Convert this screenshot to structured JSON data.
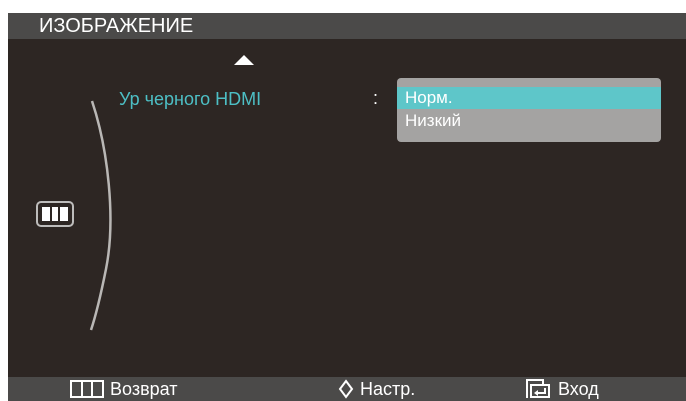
{
  "menu": {
    "title": "ИЗОБРАЖЕНИЕ"
  },
  "setting": {
    "label": "Ур черного HDMI",
    "separator": ":"
  },
  "dropdown": {
    "options": [
      "Норм.",
      "Низкий"
    ],
    "selected": "Норм."
  },
  "footer": {
    "back_label": "Возврат",
    "adjust_label": "Настр.",
    "enter_label": "Вход"
  },
  "colors": {
    "accent": "#4dbfc5",
    "selection": "#5ec6c9",
    "background": "#2d2623",
    "bar": "#4b4a49"
  },
  "icons": {
    "up": "triangle-up-icon",
    "side": "menu-bars-icon",
    "back": "menu-bars-icon",
    "adjust": "diamond-updown-icon",
    "enter": "enter-return-icon"
  }
}
